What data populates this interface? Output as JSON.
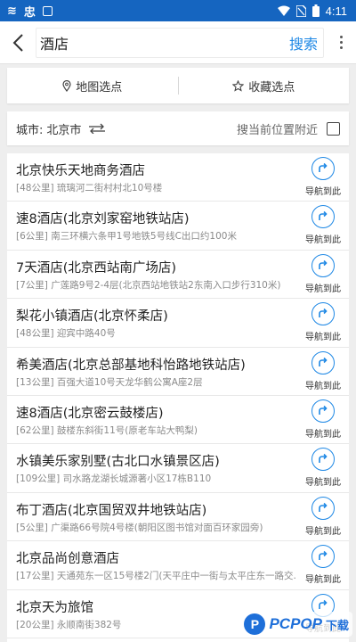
{
  "status_bar": {
    "left_glyphs": [
      "≋",
      "忠"
    ],
    "time": "4:11",
    "accent_color": "#1565c0"
  },
  "search": {
    "value": "酒店",
    "button_label": "搜索"
  },
  "pick_bar": {
    "map_pick": "地图选点",
    "fav_pick": "收藏选点"
  },
  "city_bar": {
    "label": "城市:",
    "city": "北京市",
    "nearby": "搜当前位置附近"
  },
  "results": [
    {
      "name": "北京快乐天地商务酒店",
      "address": "[48公里]  琉璃河二街村村北10号楼",
      "nav_label": "导航到此"
    },
    {
      "name": "速8酒店(北京刘家窑地铁站店)",
      "address": "[6公里]  南三环横六条甲1号地铁5号线C出口约100米",
      "nav_label": "导航到此"
    },
    {
      "name": "7天酒店(北京西站南广场店)",
      "address": "[7公里]  广莲路9号2-4层(北京西站地铁站2东南入口步行310米)",
      "nav_label": "导航到此"
    },
    {
      "name": "梨花小镇酒店(北京怀柔店)",
      "address": "[48公里]  迎宾中路40号",
      "nav_label": "导航到此"
    },
    {
      "name": "希美酒店(北京总部基地科怡路地铁站店)",
      "address": "[13公里]  百强大道10号天龙华鹤公寓A座2层",
      "nav_label": "导航到此"
    },
    {
      "name": "速8酒店(北京密云鼓楼店)",
      "address": "[62公里]  鼓楼东斜街11号(原老车站大鸭梨)",
      "nav_label": "导航到此"
    },
    {
      "name": "水镇美乐家别墅(古北口水镇景区店)",
      "address": "[109公里]  司水路龙湖长城源著小区17栋B110",
      "nav_label": "导航到此"
    },
    {
      "name": "布丁酒店(北京国贸双井地铁站店)",
      "address": "[5公里]  广渠路66号院4号楼(朝阳区图书馆对面百环家园旁)",
      "nav_label": "导航到此"
    },
    {
      "name": "北京品尚创意酒店",
      "address": "[17公里]  天通苑东一区15号楼2门(天平庄中一街与太平庄东一路交...",
      "nav_label": "导航到此"
    },
    {
      "name": "北京天为旅馆",
      "address": "[20公里]  永顺南街382号",
      "nav_label": "导航到此"
    }
  ],
  "watermark": {
    "badge": "P",
    "text": "PCPOP",
    "text_cn": "下载"
  }
}
